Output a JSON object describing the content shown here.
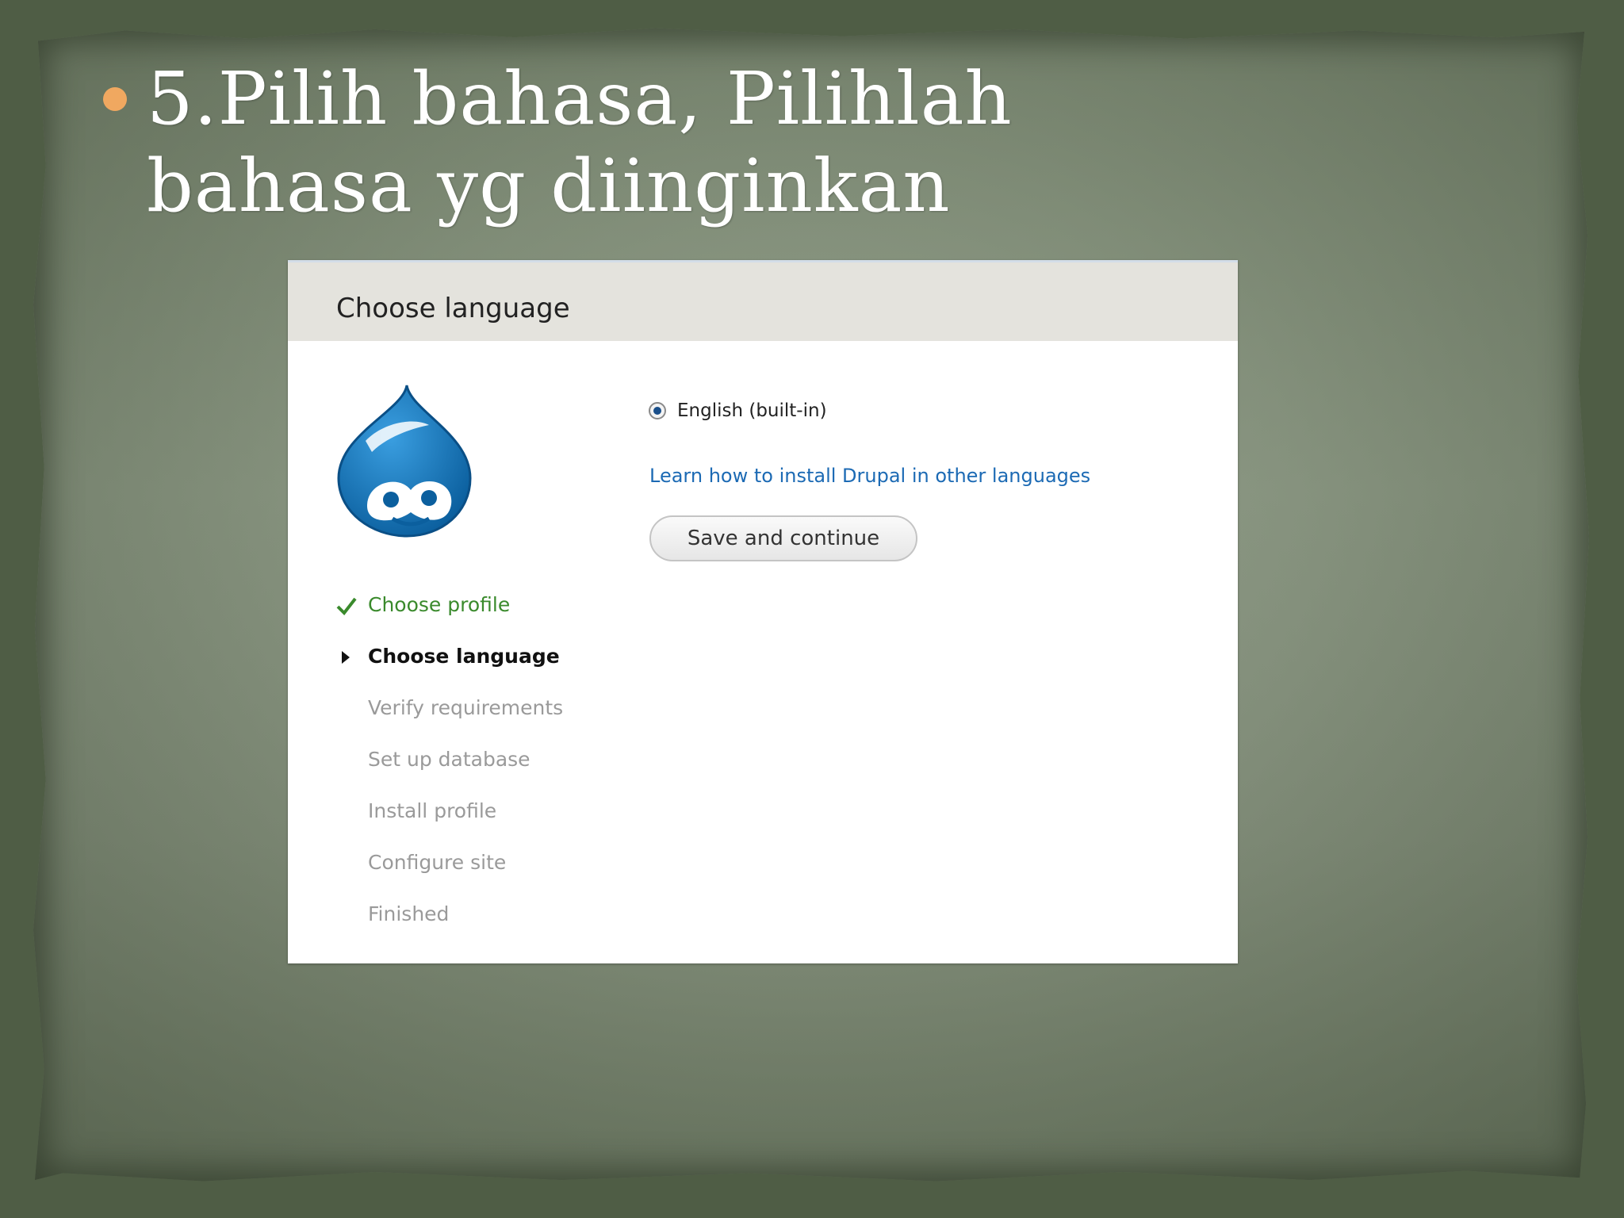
{
  "slide": {
    "title": "5.Pilih bahasa, Pilihlah bahasa yg diinginkan",
    "bullet_color": "#f0a860"
  },
  "installer": {
    "header_title": "Choose language",
    "logo_icon": "drupal-drop-logo",
    "language_option": {
      "label": "English (built-in)",
      "selected": true
    },
    "learn_link": "Learn how to install Drupal in other languages",
    "save_button": "Save and continue",
    "steps": [
      {
        "label": "Choose profile",
        "state": "done"
      },
      {
        "label": "Choose language",
        "state": "active"
      },
      {
        "label": "Verify requirements",
        "state": "pending"
      },
      {
        "label": "Set up database",
        "state": "pending"
      },
      {
        "label": "Install profile",
        "state": "pending"
      },
      {
        "label": "Configure site",
        "state": "pending"
      },
      {
        "label": "Finished",
        "state": "pending"
      }
    ],
    "colors": {
      "done": "#3a8a2c",
      "link": "#1c6ab4",
      "drupal_blue": "#0e72b9"
    }
  }
}
